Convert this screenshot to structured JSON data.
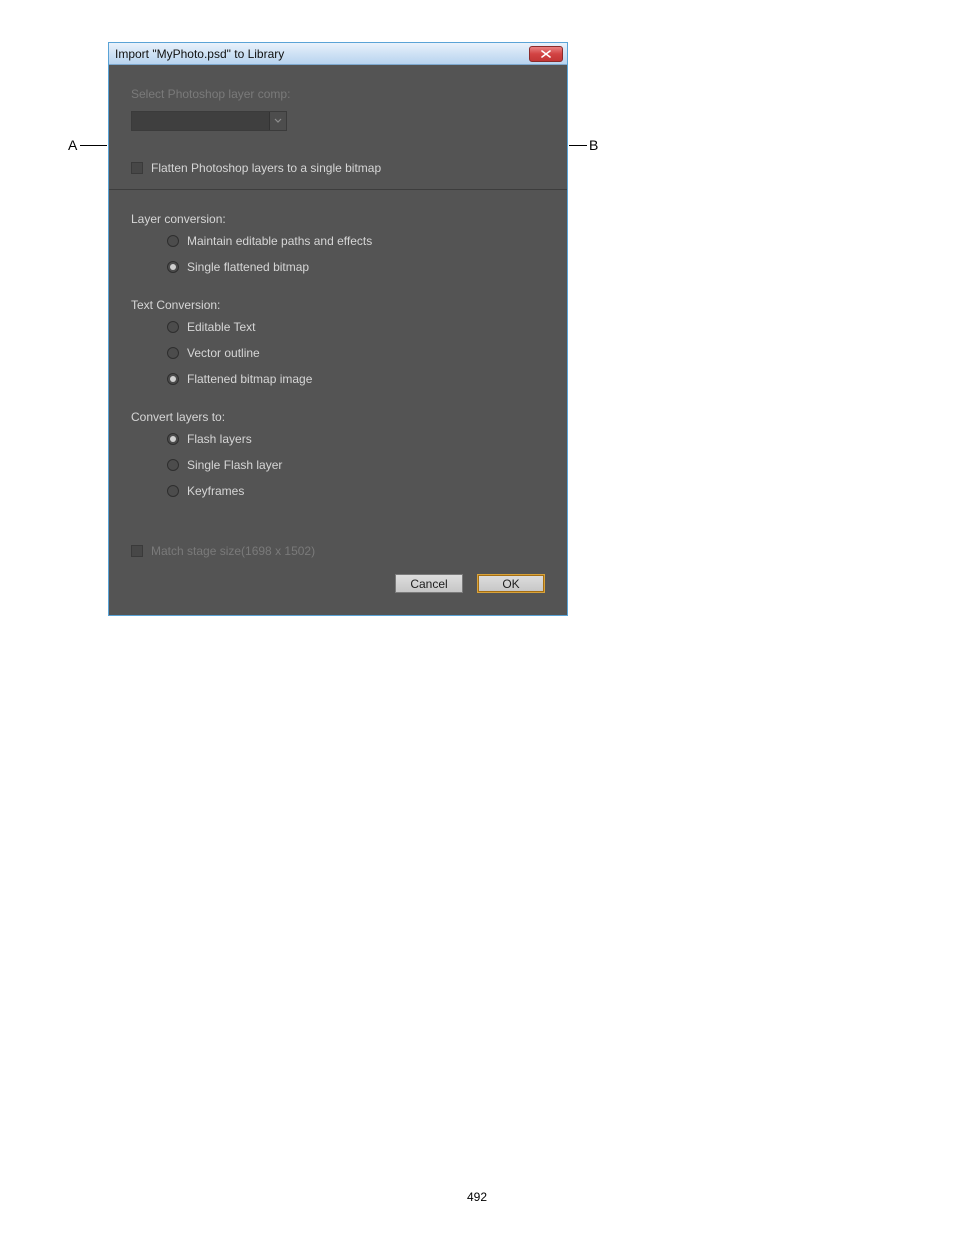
{
  "callouts": {
    "left_letter": "A",
    "right_letter": "B"
  },
  "dialog": {
    "title": "Import \"MyPhoto.psd\" to Library",
    "select_comp_label": "Select Photoshop layer comp:",
    "flatten_label": "Flatten Photoshop layers to a single bitmap",
    "layer_conversion_label": "Layer conversion:",
    "layer_conversion": {
      "maintain": "Maintain editable paths and effects",
      "single_flat": "Single flattened bitmap"
    },
    "text_conversion_label": "Text Conversion:",
    "text_conversion": {
      "editable": "Editable Text",
      "vector": "Vector outline",
      "flat": "Flattened bitmap image"
    },
    "convert_layers_label": "Convert layers to:",
    "convert_layers": {
      "flash_layers": "Flash layers",
      "single_flash": "Single Flash layer",
      "keyframes": "Keyframes"
    },
    "match_stage_label": "Match stage size(1698 x 1502)",
    "buttons": {
      "cancel": "Cancel",
      "ok": "OK"
    }
  },
  "page_number": "492"
}
